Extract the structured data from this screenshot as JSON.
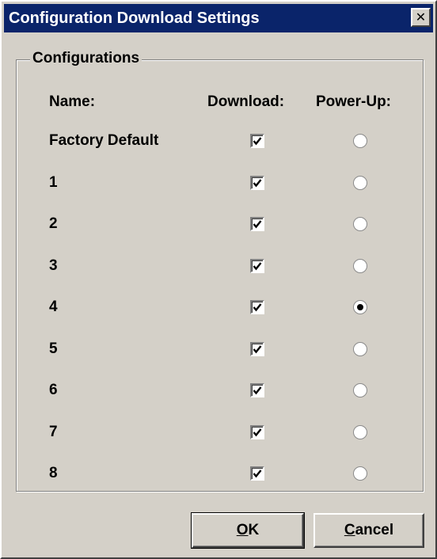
{
  "window": {
    "title": "Configuration Download Settings",
    "close_glyph": "✕"
  },
  "group": {
    "legend": "Configurations"
  },
  "columns": {
    "name": "Name:",
    "download": "Download:",
    "power_up": "Power-Up:"
  },
  "rows": [
    {
      "name": "Factory Default",
      "download": true,
      "power_up": false
    },
    {
      "name": "1",
      "download": true,
      "power_up": false
    },
    {
      "name": "2",
      "download": true,
      "power_up": false
    },
    {
      "name": "3",
      "download": true,
      "power_up": false
    },
    {
      "name": "4",
      "download": true,
      "power_up": true
    },
    {
      "name": "5",
      "download": true,
      "power_up": false
    },
    {
      "name": "6",
      "download": true,
      "power_up": false
    },
    {
      "name": "7",
      "download": true,
      "power_up": false
    },
    {
      "name": "8",
      "download": true,
      "power_up": false
    }
  ],
  "buttons": {
    "ok_mnemonic": "O",
    "ok_rest": "K",
    "cancel_mnemonic": "C",
    "cancel_rest": "ancel"
  },
  "colors": {
    "titlebar": "#0a246a",
    "face": "#d4d0c8"
  }
}
